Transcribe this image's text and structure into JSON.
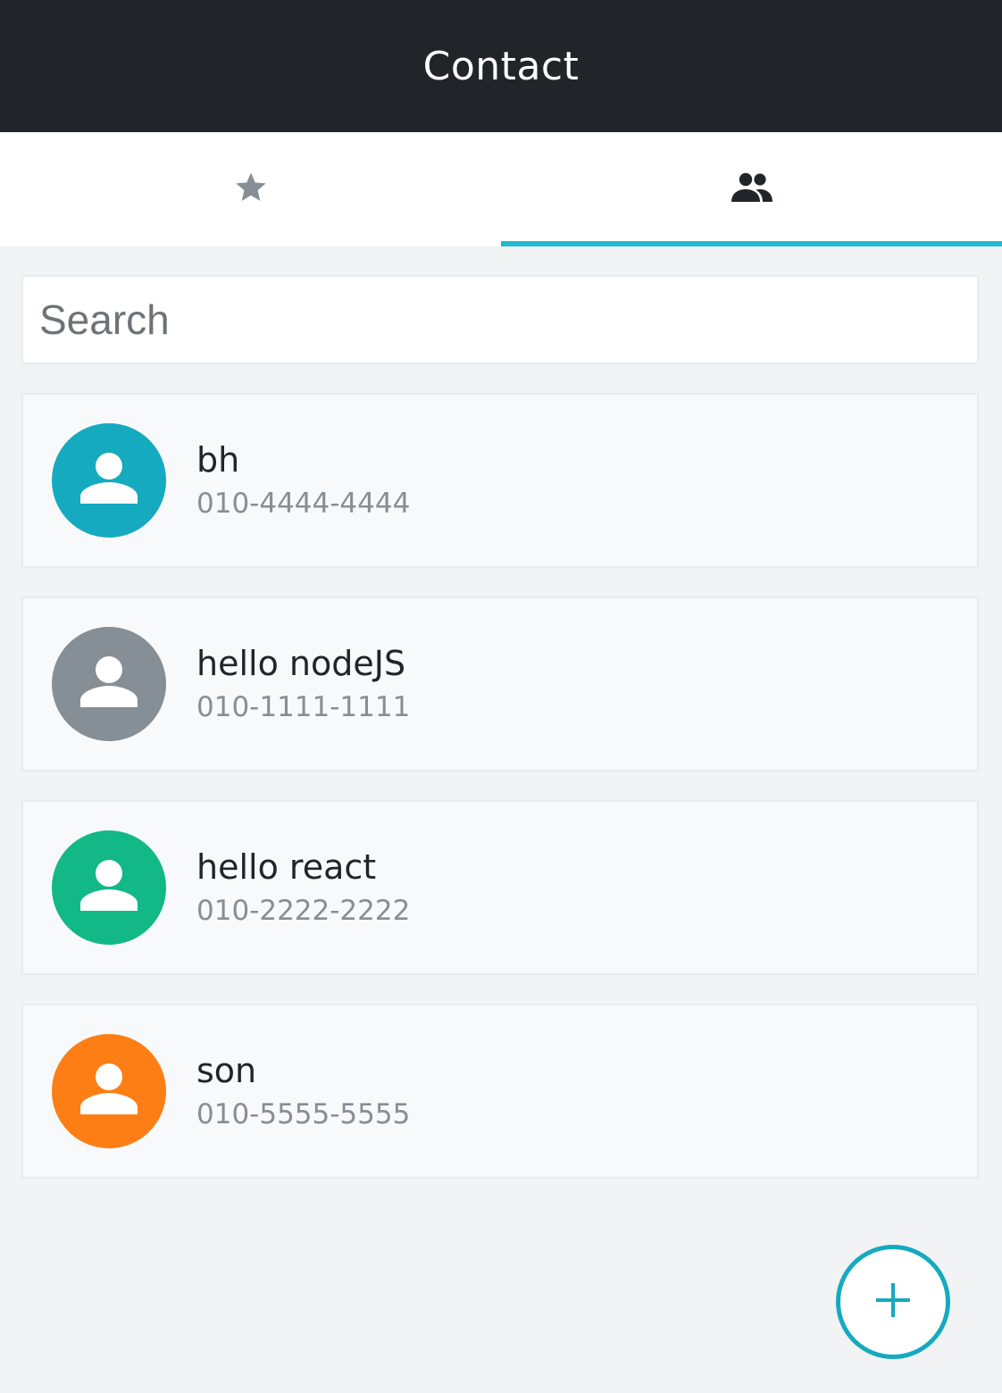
{
  "header": {
    "title": "Contact"
  },
  "tabs": [
    {
      "icon": "star-icon",
      "active": false,
      "color": "#868e96"
    },
    {
      "icon": "people-icon",
      "active": true,
      "color": "#212529"
    }
  ],
  "search": {
    "placeholder": "Search",
    "value": ""
  },
  "contacts": [
    {
      "name": "bh",
      "phone": "010-4444-4444",
      "avatar_color": "#15aabf"
    },
    {
      "name": "hello nodeJS",
      "phone": "010-1111-1111",
      "avatar_color": "#868e96"
    },
    {
      "name": "hello react",
      "phone": "010-2222-2222",
      "avatar_color": "#12b886"
    },
    {
      "name": "son",
      "phone": "010-5555-5555",
      "avatar_color": "#fd7e14"
    }
  ],
  "fab": {
    "icon": "plus-icon",
    "color": "#15aabf"
  },
  "colors": {
    "header_bg": "#212529",
    "accent": "#22b8cf",
    "page_bg": "#f1f3f5"
  }
}
